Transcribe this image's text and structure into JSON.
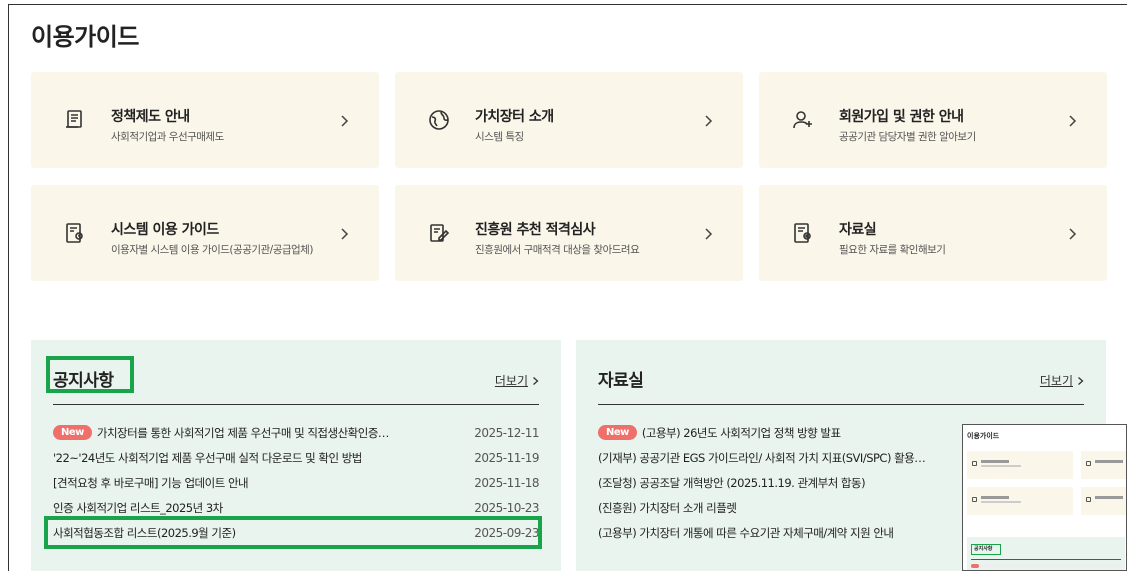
{
  "page": {
    "title": "이용가이드"
  },
  "cards": [
    {
      "title": "정책제도 안내",
      "desc": "사회적기업과 우선구매제도",
      "icon": "document-icon"
    },
    {
      "title": "가치장터 소개",
      "desc": "시스템 특징",
      "icon": "globe-icon"
    },
    {
      "title": "회원가입 및 권한 안내",
      "desc": "공공기관 담당자별 권한 알아보기",
      "icon": "add-user-icon"
    },
    {
      "title": "시스템 이용 가이드",
      "desc": "이용자별 시스템 이용 가이드(공공기관/공급업체)",
      "icon": "guide-icon"
    },
    {
      "title": "진흥원 추천 적격심사",
      "desc": "진흥원에서 구매적격 대상을 찾아드려요",
      "icon": "edit-icon"
    },
    {
      "title": "자료실",
      "desc": "필요한 자료를 확인해보기",
      "icon": "archive-icon"
    }
  ],
  "notice": {
    "title": "공지사항",
    "more": "더보기",
    "items": [
      {
        "badge": "New",
        "title": "가치장터를 통한 사회적기업 제품 우선구매 및 직접생산확인증…",
        "date": "2025-12-11"
      },
      {
        "badge": "",
        "title": "'22~'24년도 사회적기업 제품 우선구매 실적 다운로드 및 확인 방법",
        "date": "2025-11-19"
      },
      {
        "badge": "",
        "title": "[견적요청 후 바로구매] 기능 업데이트 안내",
        "date": "2025-11-18"
      },
      {
        "badge": "",
        "title": "인증 사회적기업 리스트_2025년 3차",
        "date": "2025-10-23"
      },
      {
        "badge": "",
        "title": "사회적협동조합 리스트(2025.9월 기준)",
        "date": "2025-09-23"
      }
    ]
  },
  "archive": {
    "title": "자료실",
    "more": "더보기",
    "items": [
      {
        "badge": "New",
        "title": "(고용부) 26년도 사회적기업 정책 방향 발표",
        "date": ""
      },
      {
        "badge": "",
        "title": "(기재부) 공공기관 EGS 가이드라인/ 사회적 가치 지표(SVI/SPC) 활용…",
        "date": ""
      },
      {
        "badge": "",
        "title": "(조달청) 공공조달 개혁방안 (2025.11.19. 관계부처 합동)",
        "date": ""
      },
      {
        "badge": "",
        "title": "(진흥원) 가치장터 소개 리플렛",
        "date": ""
      },
      {
        "badge": "",
        "title": "(고용부) 가치장터 개통에 따른 수요기관 자체구매/계약 지원 안내",
        "date": ""
      }
    ]
  },
  "thumbnail": {
    "title": "이용가이드",
    "notice_label": "공지사항"
  },
  "colors": {
    "card_bg": "#fbf6ea",
    "panel_bg": "#e9f4ee",
    "badge": "#ef6f6a",
    "highlight": "#19a34a"
  }
}
